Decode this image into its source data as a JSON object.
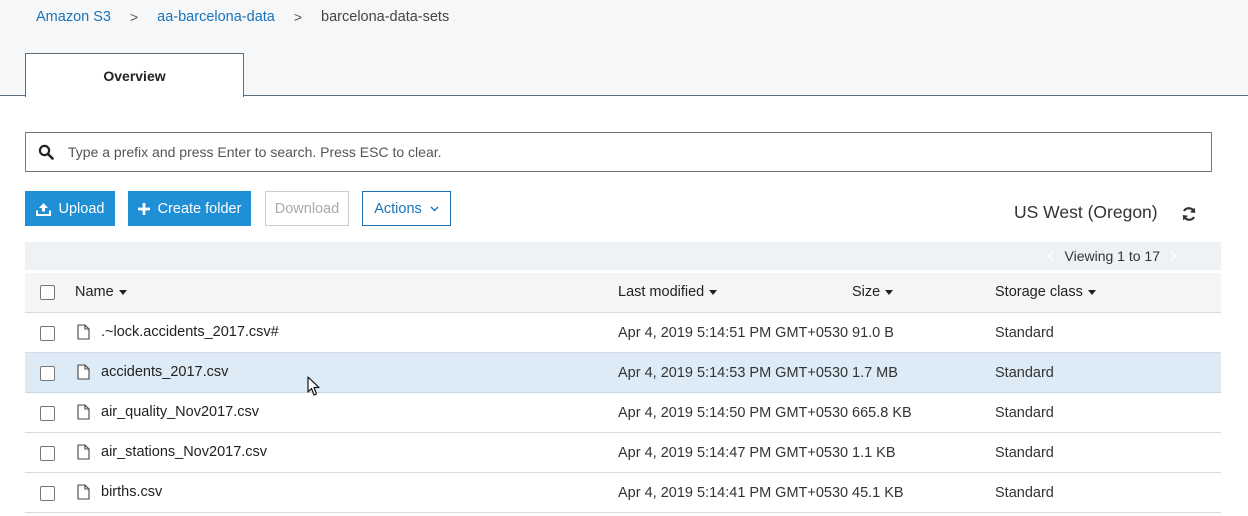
{
  "breadcrumb": {
    "items": [
      "Amazon S3",
      "aa-barcelona-data",
      "barcelona-data-sets"
    ],
    "separator": ">"
  },
  "tabs": [
    {
      "label": "Overview",
      "active": true
    }
  ],
  "search": {
    "placeholder": "Type a prefix and press Enter to search. Press ESC to clear.",
    "value": ""
  },
  "toolbar": {
    "upload_label": "Upload",
    "create_folder_label": "Create folder",
    "download_label": "Download",
    "actions_label": "Actions",
    "region": "US West (Oregon)"
  },
  "pagination": {
    "label": "Viewing 1 to 17"
  },
  "table": {
    "columns": [
      "Name",
      "Last modified",
      "Size",
      "Storage class"
    ],
    "rows": [
      {
        "name": ".~lock.accidents_2017.csv#",
        "modified": "Apr 4, 2019 5:14:51 PM GMT+0530",
        "size": "91.0 B",
        "storage": "Standard"
      },
      {
        "name": "accidents_2017.csv",
        "modified": "Apr 4, 2019 5:14:53 PM GMT+0530",
        "size": "1.7 MB",
        "storage": "Standard"
      },
      {
        "name": "air_quality_Nov2017.csv",
        "modified": "Apr 4, 2019 5:14:50 PM GMT+0530",
        "size": "665.8 KB",
        "storage": "Standard"
      },
      {
        "name": "air_stations_Nov2017.csv",
        "modified": "Apr 4, 2019 5:14:47 PM GMT+0530",
        "size": "1.1 KB",
        "storage": "Standard"
      },
      {
        "name": "births.csv",
        "modified": "Apr 4, 2019 5:14:41 PM GMT+0530",
        "size": "45.1 KB",
        "storage": "Standard"
      }
    ]
  },
  "icons": {
    "search": "search-icon",
    "upload": "upload-icon",
    "plus": "plus-icon",
    "chevron": "chevron-down-icon",
    "refresh": "refresh-icon",
    "file": "file-icon",
    "cursor": "mouse-cursor"
  },
  "colors": {
    "primary": "#1f8fd6",
    "link": "#1a73b8",
    "selected_row": "#ddebf6"
  }
}
